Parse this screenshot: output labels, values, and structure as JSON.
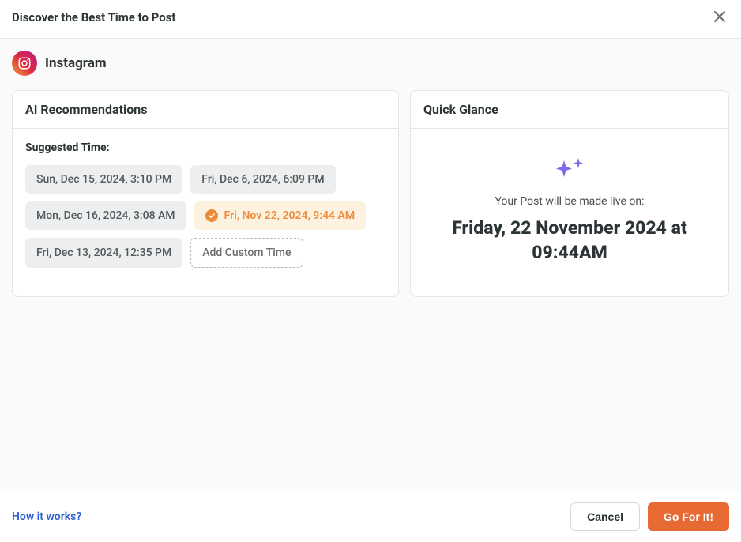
{
  "header": {
    "title": "Discover the Best Time to Post"
  },
  "platform": {
    "name": "Instagram"
  },
  "recommendations": {
    "title": "AI Recommendations",
    "suggested_label": "Suggested Time:",
    "times": [
      {
        "label": "Sun, Dec 15, 2024, 3:10 PM",
        "selected": false
      },
      {
        "label": "Fri, Dec 6, 2024, 6:09 PM",
        "selected": false
      },
      {
        "label": "Mon, Dec 16, 2024, 3:08 AM",
        "selected": false
      },
      {
        "label": "Fri, Nov 22, 2024, 9:44 AM",
        "selected": true
      },
      {
        "label": "Fri, Dec 13, 2024, 12:35 PM",
        "selected": false
      }
    ],
    "add_custom_label": "Add Custom Time"
  },
  "quick_glance": {
    "title": "Quick Glance",
    "caption": "Your Post will be made live on:",
    "datetime": "Friday, 22 November 2024 at 09:44AM"
  },
  "footer": {
    "how_it_works": "How it works?",
    "cancel": "Cancel",
    "go": "Go For It!"
  }
}
